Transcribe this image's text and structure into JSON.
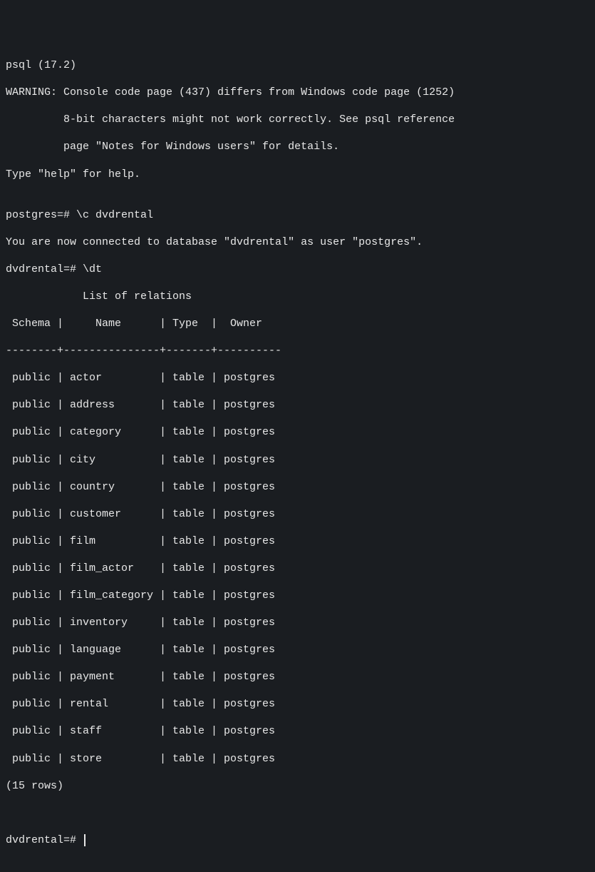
{
  "header": {
    "line1": "psql (17.2)",
    "line2": "WARNING: Console code page (437) differs from Windows code page (1252)",
    "line3": "         8-bit characters might not work correctly. See psql reference",
    "line4": "         page \"Notes for Windows users\" for details.",
    "line5": "Type \"help\" for help.",
    "blank1": ""
  },
  "connect": {
    "prompt_cmd": "postgres=# \\c dvdrental",
    "connected_msg": "You are now connected to database \"dvdrental\" as user \"postgres\"."
  },
  "dt": {
    "prompt_cmd": "dvdrental=# \\dt",
    "title": "            List of relations",
    "header_row": " Schema |     Name      | Type  |  Owner",
    "divider": "--------+---------------+-------+----------"
  },
  "rows": [
    " public | actor         | table | postgres",
    " public | address       | table | postgres",
    " public | category      | table | postgres",
    " public | city          | table | postgres",
    " public | country       | table | postgres",
    " public | customer      | table | postgres",
    " public | film          | table | postgres",
    " public | film_actor    | table | postgres",
    " public | film_category | table | postgres",
    " public | inventory     | table | postgres",
    " public | language      | table | postgres",
    " public | payment       | table | postgres",
    " public | rental        | table | postgres",
    " public | staff         | table | postgres",
    " public | store         | table | postgres"
  ],
  "row_count": "(15 rows)",
  "blank2": "",
  "blank3": "",
  "final_prompt": "dvdrental=# "
}
